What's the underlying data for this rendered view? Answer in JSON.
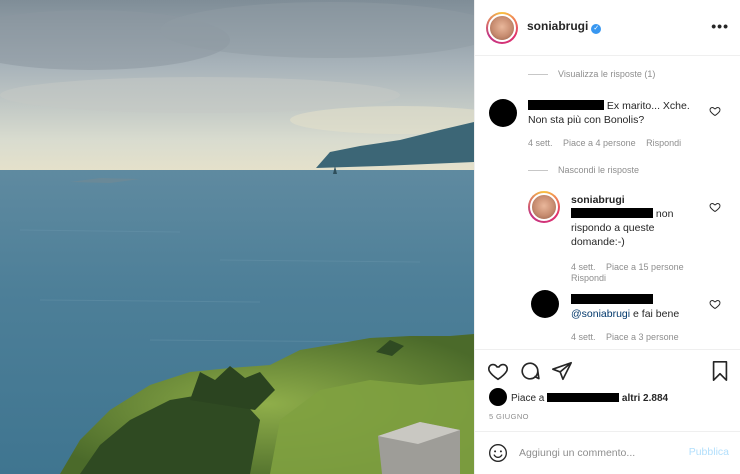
{
  "post": {
    "username": "soniabrugi",
    "verified": true,
    "more_icon": "more-horizontal-icon"
  },
  "comments": {
    "view_replies": "Visualizza le risposte (1)",
    "hide_replies": "Nascondi le risposte",
    "items": [
      {
        "text_visible": "Ex marito... Xche. Non sta più con Bonolis?",
        "text_line1": "Ex marito... Xche.",
        "text_line2": "Non sta più con Bonolis?",
        "time": "4 sett.",
        "likes": "Piace a 4 persone",
        "reply": "Rispondi"
      },
      {
        "username": "soniabrugi",
        "text_line1": "non",
        "text_line2": "rispondo a queste",
        "text_line3": "domande:-)",
        "time": "4 sett.",
        "likes": "Piace a 15 persone",
        "reply": "Rispondi"
      },
      {
        "mention": "@soniabrugi",
        "text": "e fai bene",
        "time": "4 sett.",
        "likes": "Piace a 3 persone"
      }
    ]
  },
  "actions": {
    "icons": [
      "heart-icon",
      "comment-icon",
      "share-icon",
      "bookmark-icon"
    ],
    "likes_prefix": "Piace a",
    "likes_suffix": "altri 2.884",
    "date": "5 GIUGNO"
  },
  "composer": {
    "placeholder": "Aggiungi un commento...",
    "publish_label": "Pubblica"
  },
  "colors": {
    "accent": "#3897f0",
    "publish_disabled": "#b2dffc",
    "muted": "#8e8e8e"
  }
}
